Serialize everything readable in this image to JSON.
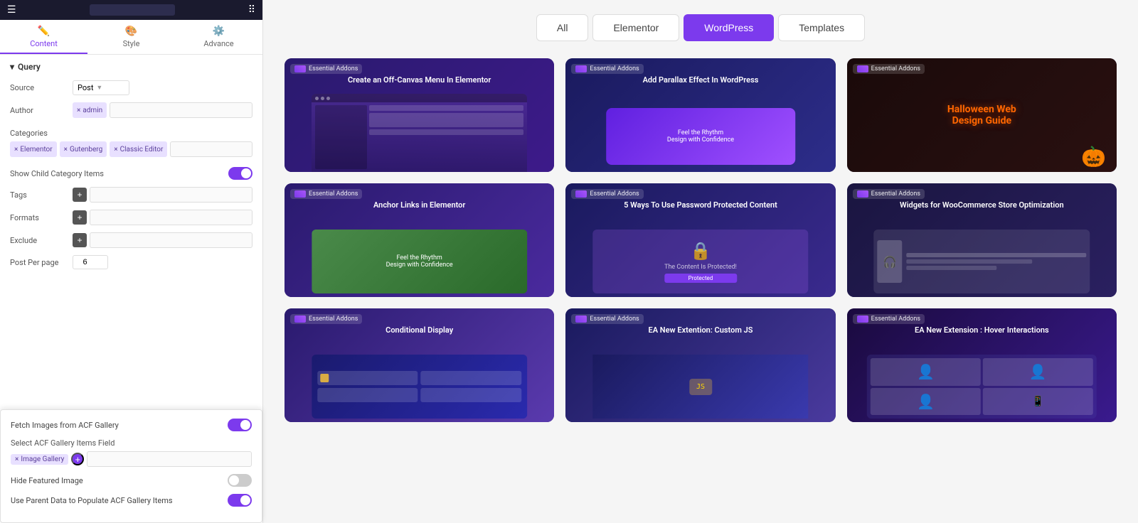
{
  "topbar": {
    "search_placeholder": ""
  },
  "tabs": [
    {
      "id": "content",
      "label": "Content",
      "icon": "✏️",
      "active": true
    },
    {
      "id": "style",
      "label": "Style",
      "icon": "🎨",
      "active": false
    },
    {
      "id": "advance",
      "label": "Advance",
      "icon": "⚙️",
      "active": false
    }
  ],
  "query_section": {
    "title": "Query",
    "source_label": "Source",
    "source_value": "Post",
    "author_label": "Author",
    "author_tag": "admin",
    "categories_label": "Categories",
    "categories_tags": [
      "Elementor",
      "Gutenberg",
      "Classic Editor"
    ],
    "show_child_label": "Show Child Category Items",
    "show_child_value": true,
    "tags_label": "Tags",
    "formats_label": "Formats",
    "exclude_label": "Exclude",
    "post_per_page_label": "Post Per page",
    "post_per_page_value": "6"
  },
  "tooltip": {
    "fetch_images_label": "Fetch Images from ACF Gallery",
    "fetch_images_value": true,
    "select_field_label": "Select ACF Gallery Items Field",
    "field_tag": "Image Gallery",
    "hide_featured_label": "Hide Featured Image",
    "hide_featured_value": false,
    "use_parent_label": "Use Parent Data to Populate ACF Gallery Items",
    "use_parent_value": true
  },
  "filter_tabs": [
    {
      "id": "all",
      "label": "All",
      "active": false
    },
    {
      "id": "elementor",
      "label": "Elementor",
      "active": false
    },
    {
      "id": "wordpress",
      "label": "WordPress",
      "active": true
    },
    {
      "id": "templates",
      "label": "Templates",
      "active": false
    }
  ],
  "cards": [
    {
      "id": 1,
      "badge": "Essential Addons",
      "title": "Create an Off-Canvas Menu In Elementor",
      "type": "screen",
      "bg": "1"
    },
    {
      "id": 2,
      "badge": "Essential Addons",
      "title": "Add Parallax Effect In WordPress",
      "type": "parallax",
      "bg": "2"
    },
    {
      "id": 3,
      "badge": "Essential Addons",
      "title": "Halloween Web Design Guide",
      "type": "halloween",
      "bg": "3"
    },
    {
      "id": 4,
      "badge": "Essential Addons",
      "title": "Anchor Links in Elementor",
      "type": "anchor",
      "bg": "4"
    },
    {
      "id": 5,
      "badge": "Essential Addons",
      "title": "5 Ways To Use Password Protected Content",
      "type": "password",
      "bg": "5"
    },
    {
      "id": 6,
      "badge": "Essential Addons",
      "title": "Widgets for WooCommerce Store Optimization",
      "type": "woo",
      "bg": "6"
    },
    {
      "id": 7,
      "badge": "Essential Addons",
      "title": "Conditional Display",
      "type": "conditional",
      "bg": "7"
    },
    {
      "id": 8,
      "badge": "Essential Addons",
      "title": "EA New Extention: Custom JS",
      "type": "js",
      "bg": "8"
    },
    {
      "id": 9,
      "badge": "Essential Addons",
      "title": "EA New Extension : Hover Interactions",
      "type": "hover",
      "bg": "9"
    }
  ]
}
